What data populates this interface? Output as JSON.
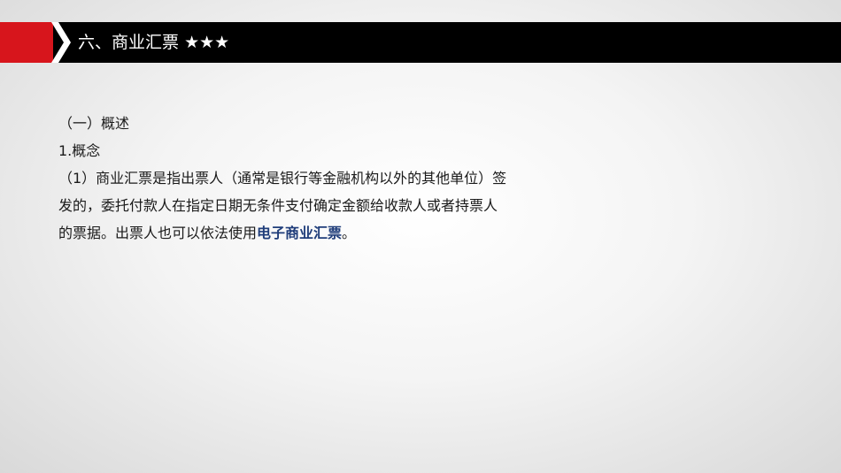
{
  "header": {
    "title": "六、商业汇票",
    "stars": "★★★"
  },
  "content": {
    "section_heading": "（一）概述",
    "subheading": "1.概念",
    "paragraph_line1": "（1）商业汇票是指出票人（通常是银行等金融机构以外的其他单位）签",
    "paragraph_line2": "发的，委托付款人在指定日期无条件支付确定金额给收款人或者持票人",
    "paragraph_line3_pre": "的票据。出票人也可以依法使用",
    "paragraph_line3_highlight": "电子商业汇票",
    "paragraph_line3_post": "。"
  },
  "colors": {
    "accent_red": "#d7151c",
    "title_bar": "#000000",
    "highlight_blue": "#1f3d7a"
  }
}
